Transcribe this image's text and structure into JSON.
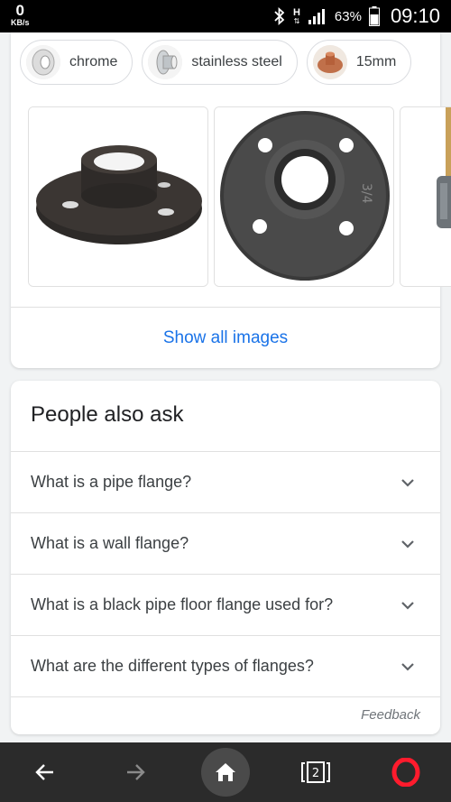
{
  "status_bar": {
    "speed_value": "0",
    "speed_unit": "KB/s",
    "network": "H",
    "battery_percent": "63%",
    "time": "09:10"
  },
  "chips": [
    {
      "label": "chrome",
      "icon": "chrome-flange-thumb"
    },
    {
      "label": "stainless steel",
      "icon": "stainless-flange-thumb"
    },
    {
      "label": "15mm",
      "icon": "copper-flange-thumb"
    }
  ],
  "images": {
    "show_all_label": "Show all images"
  },
  "people_also_ask": {
    "title": "People also ask",
    "questions": [
      "What is a pipe flange?",
      "What is a wall flange?",
      "What is a black pipe floor flange used for?",
      "What are the different types of flanges?"
    ],
    "feedback_label": "Feedback"
  },
  "navbar": {
    "tab_count": "2",
    "accent_color": "#ff1b2d"
  }
}
